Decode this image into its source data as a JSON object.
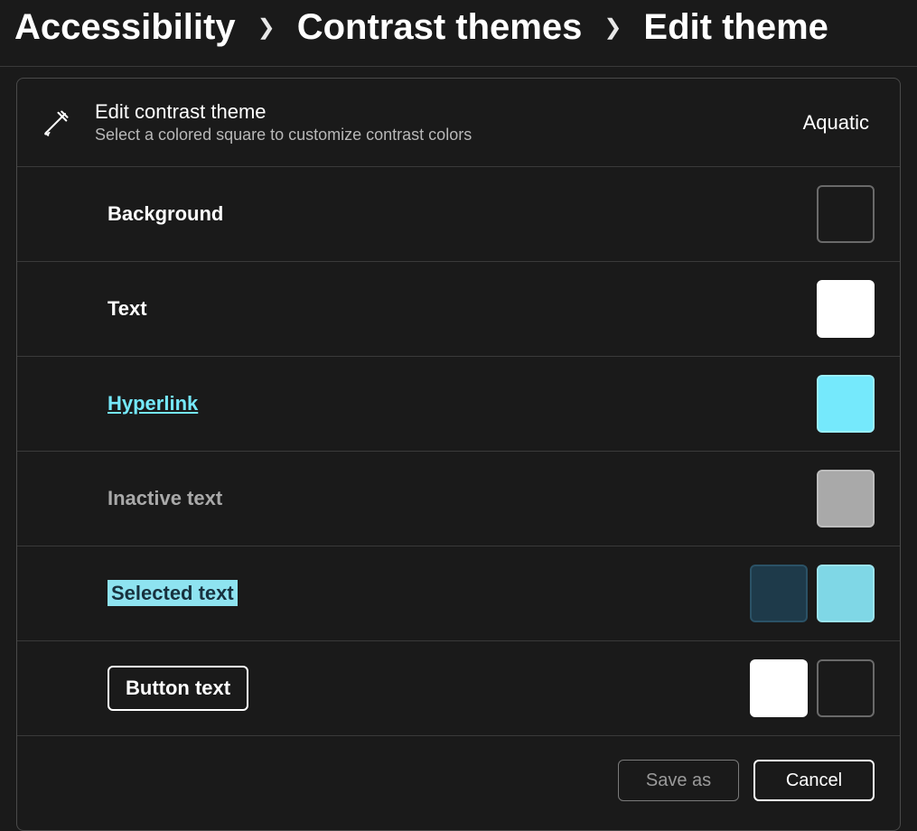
{
  "breadcrumb": {
    "level1": "Accessibility",
    "level2": "Contrast themes",
    "level3": "Edit theme"
  },
  "header": {
    "title": "Edit contrast theme",
    "subtitle": "Select a colored square to customize contrast colors",
    "theme_name": "Aquatic"
  },
  "rows": {
    "background": {
      "label": "Background",
      "swatch": "#1a1a1a"
    },
    "text": {
      "label": "Text",
      "swatch": "#ffffff"
    },
    "hyperlink": {
      "label": "Hyperlink",
      "swatch": "#75e9fc"
    },
    "inactive": {
      "label": "Inactive text",
      "swatch": "#a9a9a9"
    },
    "selected": {
      "label": "Selected text",
      "swatch_fg": "#1e3a4a",
      "swatch_bg": "#7fd7e6"
    },
    "button": {
      "label": "Button text",
      "swatch_fg": "#ffffff",
      "swatch_bg": "#1a1a1a"
    }
  },
  "footer": {
    "save_as": "Save as",
    "cancel": "Cancel"
  }
}
